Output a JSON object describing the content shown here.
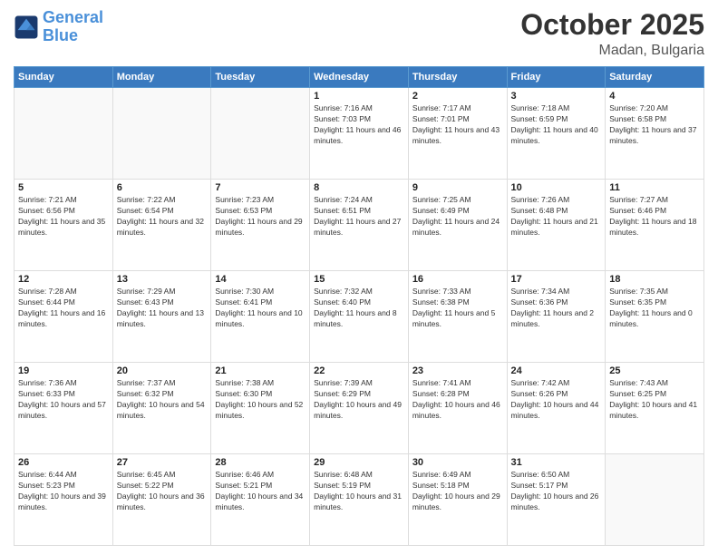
{
  "header": {
    "logo_line1": "General",
    "logo_line2": "Blue",
    "month": "October 2025",
    "location": "Madan, Bulgaria"
  },
  "weekdays": [
    "Sunday",
    "Monday",
    "Tuesday",
    "Wednesday",
    "Thursday",
    "Friday",
    "Saturday"
  ],
  "weeks": [
    [
      {
        "day": "",
        "info": ""
      },
      {
        "day": "",
        "info": ""
      },
      {
        "day": "",
        "info": ""
      },
      {
        "day": "1",
        "info": "Sunrise: 7:16 AM\nSunset: 7:03 PM\nDaylight: 11 hours and 46 minutes."
      },
      {
        "day": "2",
        "info": "Sunrise: 7:17 AM\nSunset: 7:01 PM\nDaylight: 11 hours and 43 minutes."
      },
      {
        "day": "3",
        "info": "Sunrise: 7:18 AM\nSunset: 6:59 PM\nDaylight: 11 hours and 40 minutes."
      },
      {
        "day": "4",
        "info": "Sunrise: 7:20 AM\nSunset: 6:58 PM\nDaylight: 11 hours and 37 minutes."
      }
    ],
    [
      {
        "day": "5",
        "info": "Sunrise: 7:21 AM\nSunset: 6:56 PM\nDaylight: 11 hours and 35 minutes."
      },
      {
        "day": "6",
        "info": "Sunrise: 7:22 AM\nSunset: 6:54 PM\nDaylight: 11 hours and 32 minutes."
      },
      {
        "day": "7",
        "info": "Sunrise: 7:23 AM\nSunset: 6:53 PM\nDaylight: 11 hours and 29 minutes."
      },
      {
        "day": "8",
        "info": "Sunrise: 7:24 AM\nSunset: 6:51 PM\nDaylight: 11 hours and 27 minutes."
      },
      {
        "day": "9",
        "info": "Sunrise: 7:25 AM\nSunset: 6:49 PM\nDaylight: 11 hours and 24 minutes."
      },
      {
        "day": "10",
        "info": "Sunrise: 7:26 AM\nSunset: 6:48 PM\nDaylight: 11 hours and 21 minutes."
      },
      {
        "day": "11",
        "info": "Sunrise: 7:27 AM\nSunset: 6:46 PM\nDaylight: 11 hours and 18 minutes."
      }
    ],
    [
      {
        "day": "12",
        "info": "Sunrise: 7:28 AM\nSunset: 6:44 PM\nDaylight: 11 hours and 16 minutes."
      },
      {
        "day": "13",
        "info": "Sunrise: 7:29 AM\nSunset: 6:43 PM\nDaylight: 11 hours and 13 minutes."
      },
      {
        "day": "14",
        "info": "Sunrise: 7:30 AM\nSunset: 6:41 PM\nDaylight: 11 hours and 10 minutes."
      },
      {
        "day": "15",
        "info": "Sunrise: 7:32 AM\nSunset: 6:40 PM\nDaylight: 11 hours and 8 minutes."
      },
      {
        "day": "16",
        "info": "Sunrise: 7:33 AM\nSunset: 6:38 PM\nDaylight: 11 hours and 5 minutes."
      },
      {
        "day": "17",
        "info": "Sunrise: 7:34 AM\nSunset: 6:36 PM\nDaylight: 11 hours and 2 minutes."
      },
      {
        "day": "18",
        "info": "Sunrise: 7:35 AM\nSunset: 6:35 PM\nDaylight: 11 hours and 0 minutes."
      }
    ],
    [
      {
        "day": "19",
        "info": "Sunrise: 7:36 AM\nSunset: 6:33 PM\nDaylight: 10 hours and 57 minutes."
      },
      {
        "day": "20",
        "info": "Sunrise: 7:37 AM\nSunset: 6:32 PM\nDaylight: 10 hours and 54 minutes."
      },
      {
        "day": "21",
        "info": "Sunrise: 7:38 AM\nSunset: 6:30 PM\nDaylight: 10 hours and 52 minutes."
      },
      {
        "day": "22",
        "info": "Sunrise: 7:39 AM\nSunset: 6:29 PM\nDaylight: 10 hours and 49 minutes."
      },
      {
        "day": "23",
        "info": "Sunrise: 7:41 AM\nSunset: 6:28 PM\nDaylight: 10 hours and 46 minutes."
      },
      {
        "day": "24",
        "info": "Sunrise: 7:42 AM\nSunset: 6:26 PM\nDaylight: 10 hours and 44 minutes."
      },
      {
        "day": "25",
        "info": "Sunrise: 7:43 AM\nSunset: 6:25 PM\nDaylight: 10 hours and 41 minutes."
      }
    ],
    [
      {
        "day": "26",
        "info": "Sunrise: 6:44 AM\nSunset: 5:23 PM\nDaylight: 10 hours and 39 minutes."
      },
      {
        "day": "27",
        "info": "Sunrise: 6:45 AM\nSunset: 5:22 PM\nDaylight: 10 hours and 36 minutes."
      },
      {
        "day": "28",
        "info": "Sunrise: 6:46 AM\nSunset: 5:21 PM\nDaylight: 10 hours and 34 minutes."
      },
      {
        "day": "29",
        "info": "Sunrise: 6:48 AM\nSunset: 5:19 PM\nDaylight: 10 hours and 31 minutes."
      },
      {
        "day": "30",
        "info": "Sunrise: 6:49 AM\nSunset: 5:18 PM\nDaylight: 10 hours and 29 minutes."
      },
      {
        "day": "31",
        "info": "Sunrise: 6:50 AM\nSunset: 5:17 PM\nDaylight: 10 hours and 26 minutes."
      },
      {
        "day": "",
        "info": ""
      }
    ]
  ]
}
